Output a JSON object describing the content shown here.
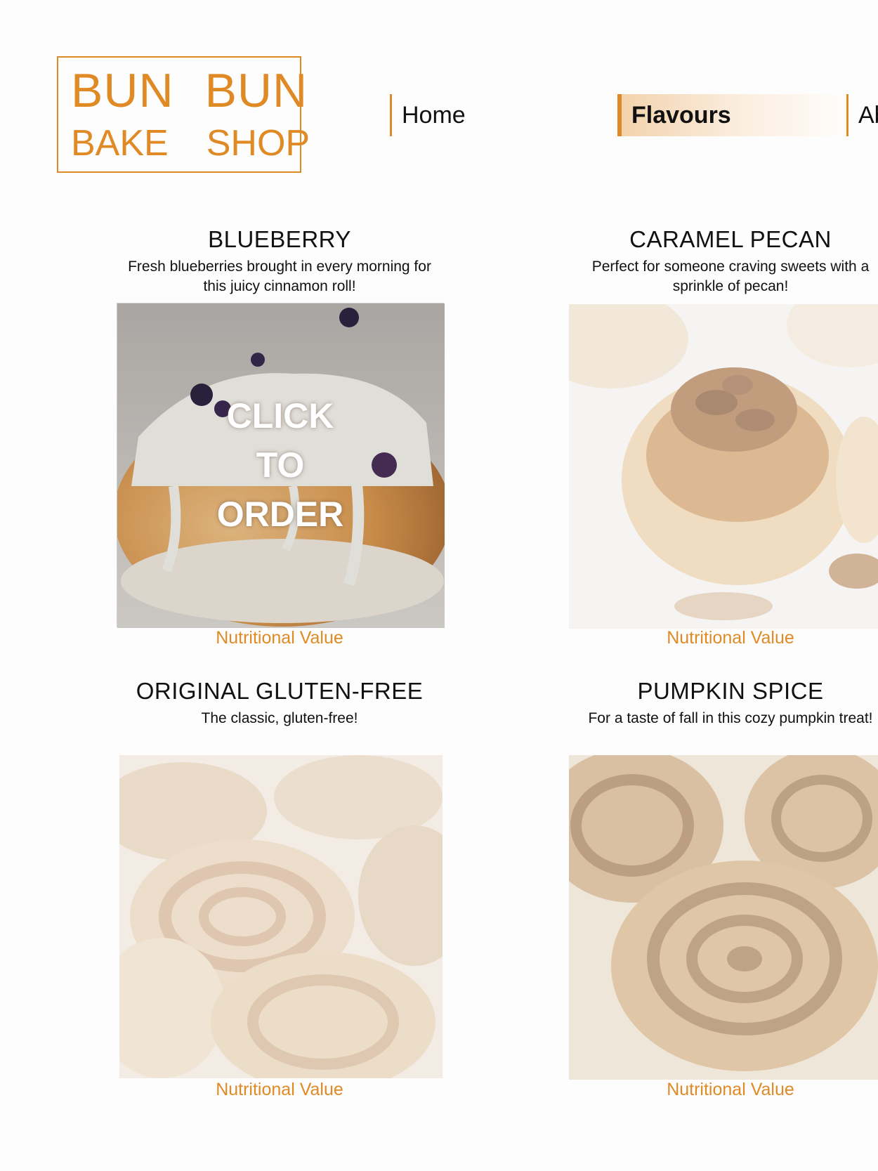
{
  "logo": {
    "line1_word1": "BUN",
    "line1_word2": "BUN",
    "line2_word1": "BAKE",
    "line2_word2": "SHOP"
  },
  "nav": {
    "home": "Home",
    "flavours": "Flavours",
    "about": "Ab"
  },
  "products": [
    {
      "title": "BLUEBERRY",
      "desc_line1": "Fresh blueberries brought in every morning for",
      "desc_line2": "this juicy cinnamon roll!",
      "nutrition": "Nutritional Value",
      "overlay": [
        "CLICK",
        "TO",
        "ORDER"
      ]
    },
    {
      "title": "CARAMEL PECAN",
      "desc_line1": "Perfect for someone craving sweets with a",
      "desc_line2": "sprinkle of pecan!",
      "nutrition": "Nutritional Value"
    },
    {
      "title": "ORIGINAL GLUTEN-FREE",
      "desc_line1": "The classic, gluten-free!",
      "desc_line2": "",
      "nutrition": "Nutritional Value"
    },
    {
      "title": "PUMPKIN SPICE",
      "desc_line1": "For a taste of fall in this cozy pumpkin treat!",
      "desc_line2": "",
      "nutrition": "Nutritional Value"
    }
  ],
  "colors": {
    "accent": "#e08a25",
    "highlight": "#f3d3ad"
  }
}
